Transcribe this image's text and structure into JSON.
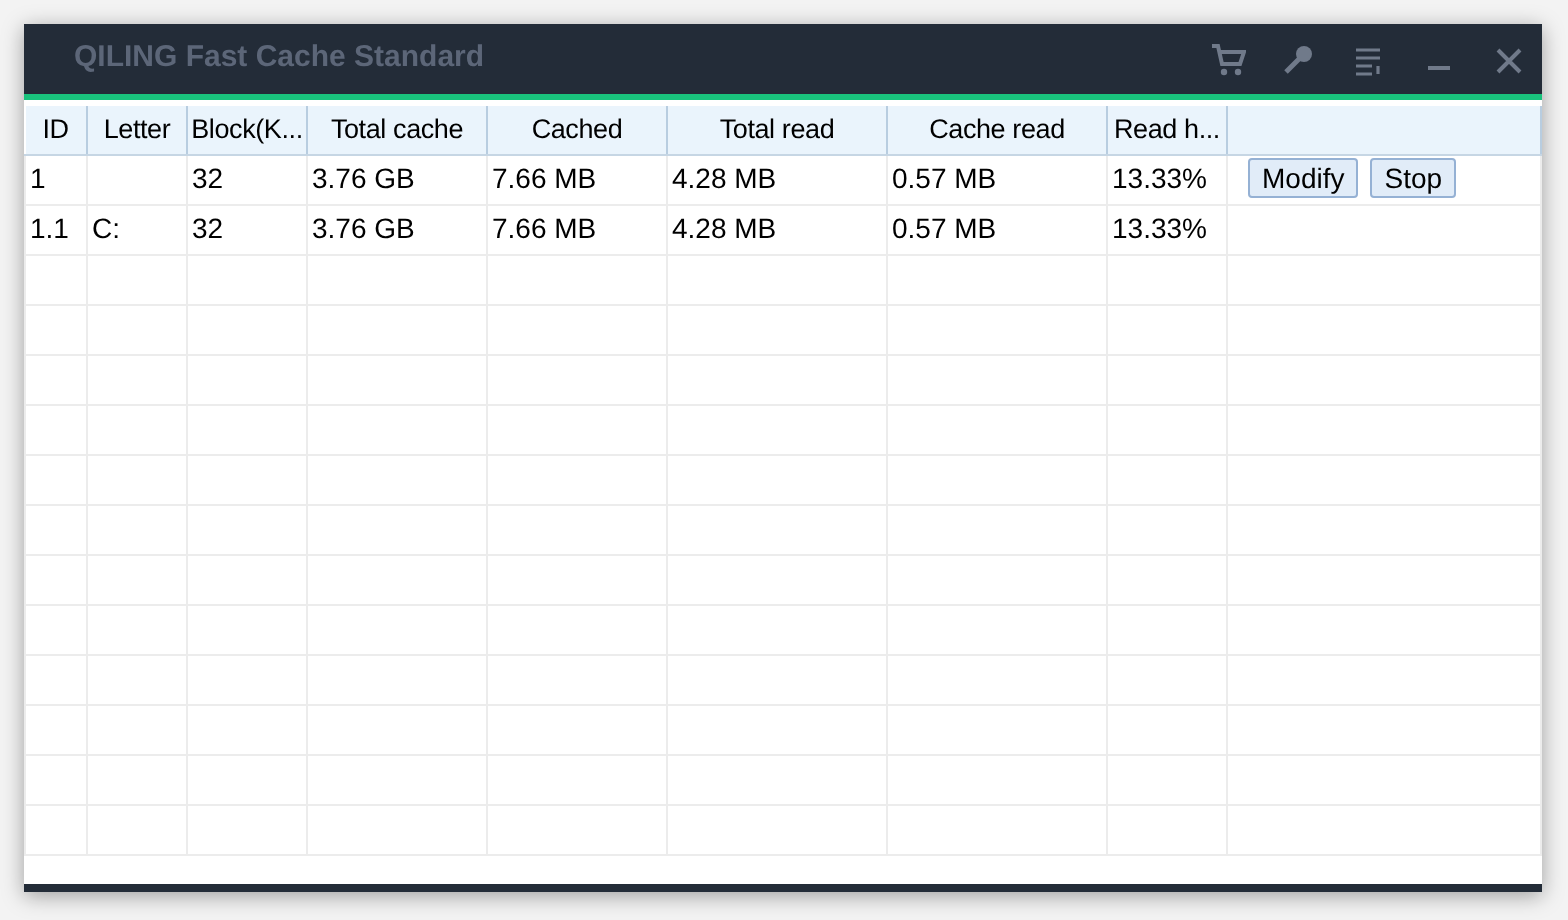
{
  "window": {
    "title": "QILING Fast Cache Standard"
  },
  "title_buttons": [
    {
      "kind": "cart"
    },
    {
      "kind": "key"
    },
    {
      "kind": "menu"
    },
    {
      "kind": "minimize"
    },
    {
      "kind": "close"
    }
  ],
  "table": {
    "columns": [
      "ID",
      "Letter",
      "Block(K...",
      "Total cache",
      "Cached",
      "Total read",
      "Cache read",
      "Read h..."
    ],
    "rows": [
      {
        "cells": [
          "1",
          "",
          "32",
          "3.76 GB",
          "7.66 MB",
          "4.28 MB",
          "0.57 MB",
          "13.33%"
        ],
        "actions": [
          "Modify",
          "Stop"
        ]
      },
      {
        "cells": [
          "1.1",
          "C:",
          "32",
          "3.76 GB",
          "7.66 MB",
          "4.28 MB",
          "0.57 MB",
          "13.33%"
        ],
        "actions": []
      }
    ]
  }
}
